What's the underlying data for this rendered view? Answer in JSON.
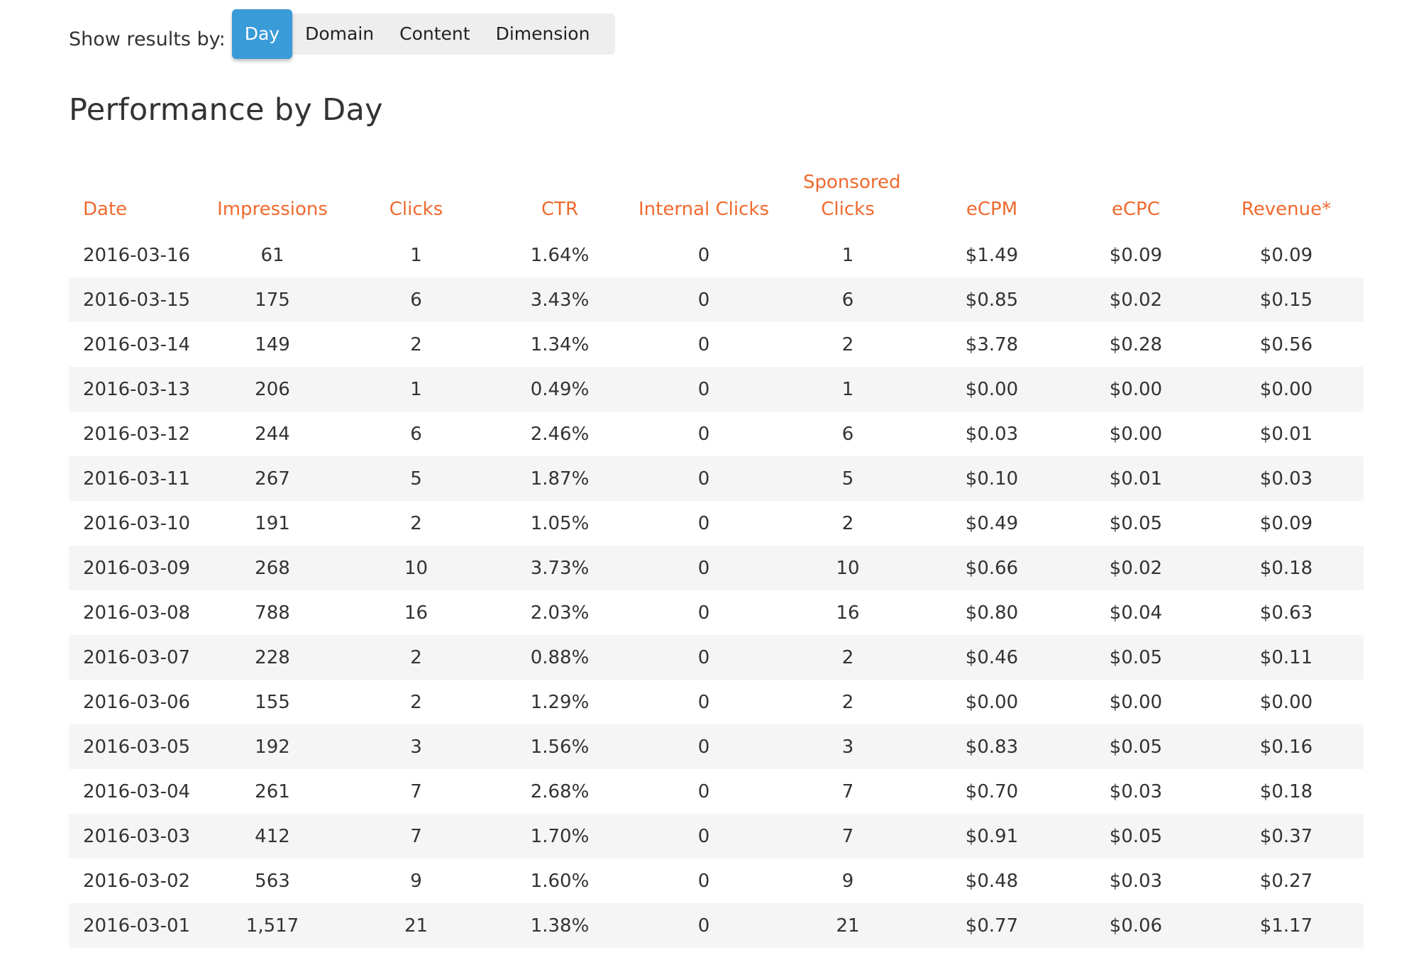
{
  "filter": {
    "label": "Show results by:",
    "options": [
      "Day",
      "Domain",
      "Content",
      "Dimension"
    ],
    "selected": "Day"
  },
  "colors": {
    "accent": "#3a9bd9",
    "header_text": "#ef6a2f",
    "stripe": "#f5f5f5"
  },
  "page_title": "Performance by Day",
  "table": {
    "columns": [
      "Date",
      "Impressions",
      "Clicks",
      "CTR",
      "Internal Clicks",
      "Sponsored Clicks",
      "eCPM",
      "eCPC",
      "Revenue*"
    ],
    "rows": [
      [
        "2016-03-16",
        "61",
        "1",
        "1.64%",
        "0",
        "1",
        "$1.49",
        "$0.09",
        "$0.09"
      ],
      [
        "2016-03-15",
        "175",
        "6",
        "3.43%",
        "0",
        "6",
        "$0.85",
        "$0.02",
        "$0.15"
      ],
      [
        "2016-03-14",
        "149",
        "2",
        "1.34%",
        "0",
        "2",
        "$3.78",
        "$0.28",
        "$0.56"
      ],
      [
        "2016-03-13",
        "206",
        "1",
        "0.49%",
        "0",
        "1",
        "$0.00",
        "$0.00",
        "$0.00"
      ],
      [
        "2016-03-12",
        "244",
        "6",
        "2.46%",
        "0",
        "6",
        "$0.03",
        "$0.00",
        "$0.01"
      ],
      [
        "2016-03-11",
        "267",
        "5",
        "1.87%",
        "0",
        "5",
        "$0.10",
        "$0.01",
        "$0.03"
      ],
      [
        "2016-03-10",
        "191",
        "2",
        "1.05%",
        "0",
        "2",
        "$0.49",
        "$0.05",
        "$0.09"
      ],
      [
        "2016-03-09",
        "268",
        "10",
        "3.73%",
        "0",
        "10",
        "$0.66",
        "$0.02",
        "$0.18"
      ],
      [
        "2016-03-08",
        "788",
        "16",
        "2.03%",
        "0",
        "16",
        "$0.80",
        "$0.04",
        "$0.63"
      ],
      [
        "2016-03-07",
        "228",
        "2",
        "0.88%",
        "0",
        "2",
        "$0.46",
        "$0.05",
        "$0.11"
      ],
      [
        "2016-03-06",
        "155",
        "2",
        "1.29%",
        "0",
        "2",
        "$0.00",
        "$0.00",
        "$0.00"
      ],
      [
        "2016-03-05",
        "192",
        "3",
        "1.56%",
        "0",
        "3",
        "$0.83",
        "$0.05",
        "$0.16"
      ],
      [
        "2016-03-04",
        "261",
        "7",
        "2.68%",
        "0",
        "7",
        "$0.70",
        "$0.03",
        "$0.18"
      ],
      [
        "2016-03-03",
        "412",
        "7",
        "1.70%",
        "0",
        "7",
        "$0.91",
        "$0.05",
        "$0.37"
      ],
      [
        "2016-03-02",
        "563",
        "9",
        "1.60%",
        "0",
        "9",
        "$0.48",
        "$0.03",
        "$0.27"
      ],
      [
        "2016-03-01",
        "1,517",
        "21",
        "1.38%",
        "0",
        "21",
        "$0.77",
        "$0.06",
        "$1.17"
      ]
    ]
  }
}
